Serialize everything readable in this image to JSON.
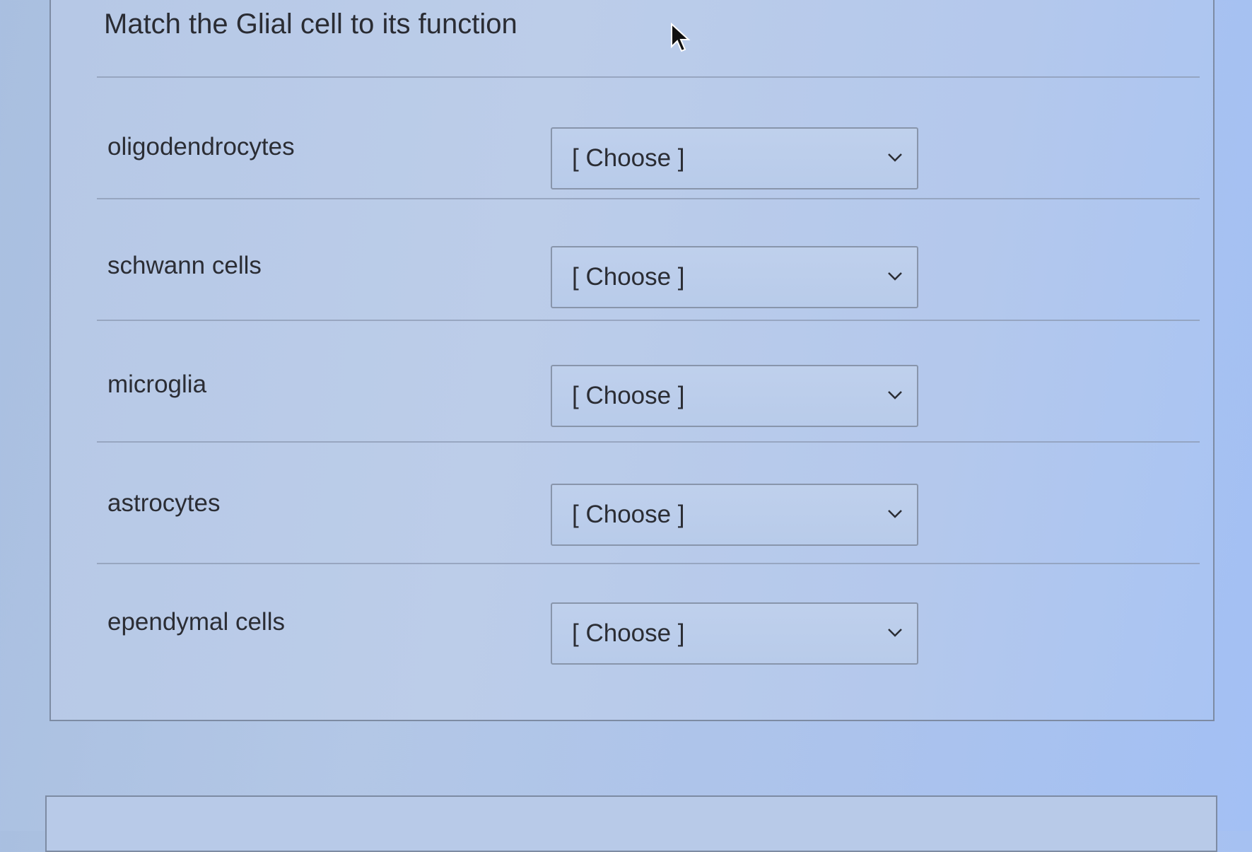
{
  "question": {
    "title": "Match the Glial cell to its function"
  },
  "rows": [
    {
      "term": "oligodendrocytes",
      "selected": "[ Choose ]"
    },
    {
      "term": "schwann cells",
      "selected": "[ Choose ]"
    },
    {
      "term": "microglia",
      "selected": "[ Choose ]"
    },
    {
      "term": "astrocytes",
      "selected": "[ Choose ]"
    },
    {
      "term": "ependymal cells",
      "selected": "[ Choose ]"
    }
  ],
  "icons": {
    "cursor": "mouse-pointer-arrow",
    "dropdown": "chevron-down"
  },
  "colors": {
    "text": "#2b2d34",
    "border": "#8895ab"
  }
}
